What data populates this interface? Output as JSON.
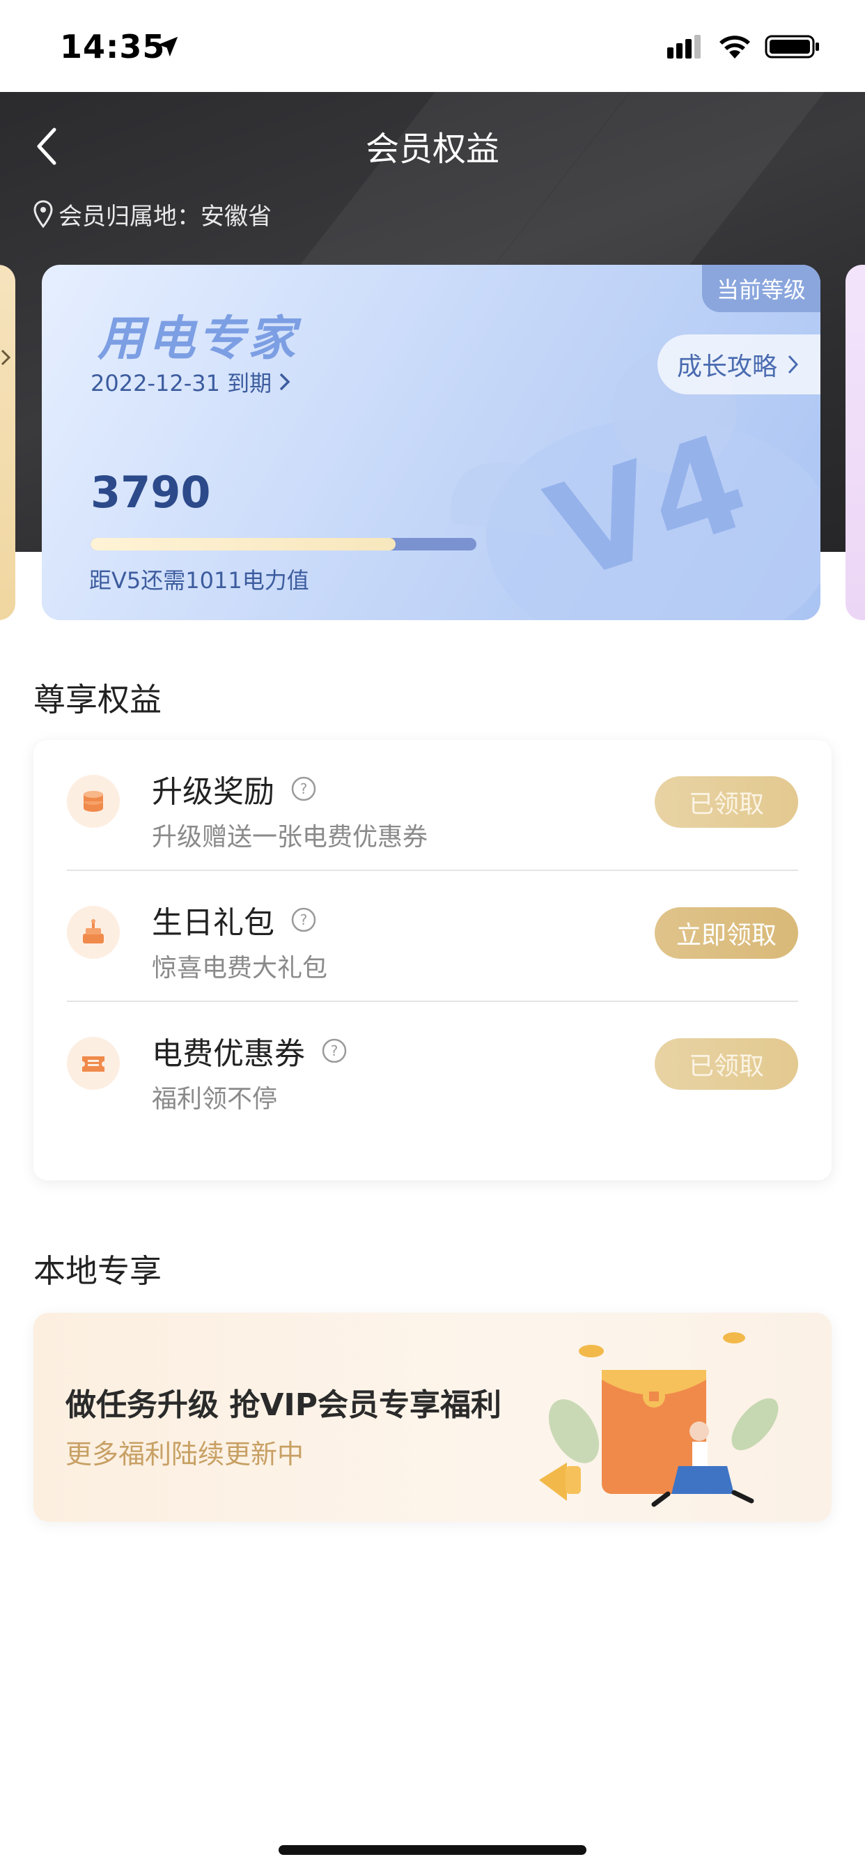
{
  "status_bar": {
    "time": "14:35"
  },
  "header": {
    "title": "会员权益",
    "region": "会员归属地：安徽省"
  },
  "level_card": {
    "name": "用电专家",
    "expiry": "2022-12-31 到期",
    "current_tag": "当前等级",
    "growth_label": "成长攻略",
    "points": "3790",
    "progress": 0.79,
    "progress_note": "距V5还需1011电力值",
    "badge": "V4"
  },
  "benefits": {
    "title": "尊享权益",
    "items": [
      {
        "title": "升级奖励",
        "subtitle": "升级赠送一张电费优惠券",
        "button": "已领取",
        "icon": "coin-stack-icon"
      },
      {
        "title": "生日礼包",
        "subtitle": "惊喜电费大礼包",
        "button": "立即领取",
        "icon": "cake-icon"
      },
      {
        "title": "电费优惠券",
        "subtitle": "福利领不停",
        "button": "已领取",
        "icon": "coupon-icon"
      }
    ]
  },
  "local": {
    "title": "本地专享",
    "promo_title": "做任务升级 抢VIP会员专享福利",
    "promo_subtitle": "更多福利陆续更新中"
  },
  "colors": {
    "accent_gold": "#d9b978",
    "card_blue": "#aac4f3",
    "header_dark": "#2b2b2e"
  }
}
